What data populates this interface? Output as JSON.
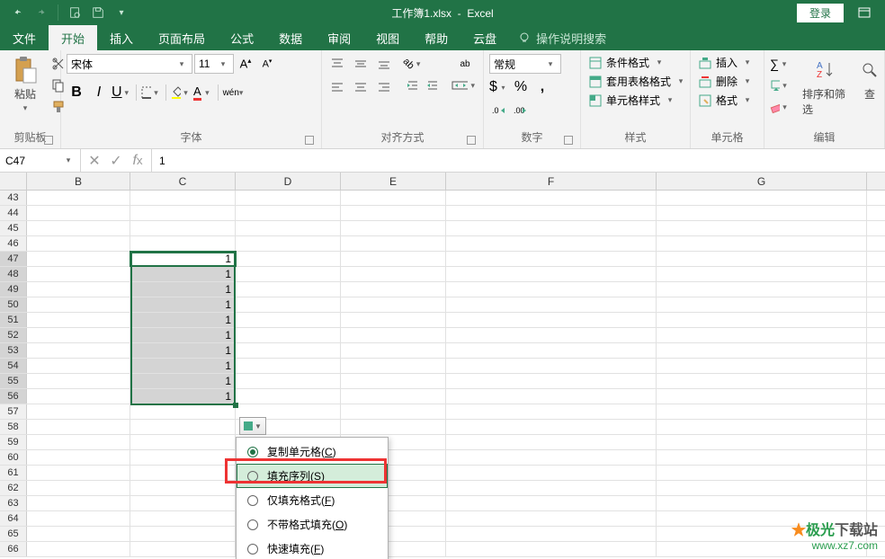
{
  "title": {
    "filename": "工作簿1.xlsx",
    "app": "Excel",
    "separator": "-"
  },
  "login_button": "登录",
  "tabs": {
    "file": "文件",
    "home": "开始",
    "insert": "插入",
    "layout": "页面布局",
    "formula": "公式",
    "data": "数据",
    "review": "审阅",
    "view": "视图",
    "help": "帮助",
    "cloud": "云盘",
    "tellme": "操作说明搜索"
  },
  "ribbon": {
    "clipboard": {
      "label": "剪贴板",
      "paste": "粘贴"
    },
    "font": {
      "label": "字体",
      "name": "宋体",
      "size": "11",
      "bold": "B",
      "italic": "I",
      "underline": "U",
      "ruby": "wén"
    },
    "alignment": {
      "label": "对齐方式",
      "wrap": "ab"
    },
    "number": {
      "label": "数字",
      "format": "常规",
      "currency": "$",
      "percent": "%",
      "comma": ","
    },
    "styles": {
      "label": "样式",
      "cond": "条件格式",
      "table": "套用表格格式",
      "cell": "单元格样式"
    },
    "cells": {
      "label": "单元格",
      "insert": "插入",
      "delete": "删除",
      "format": "格式"
    },
    "editing": {
      "label": "编辑",
      "sort": "排序和筛选",
      "find": "查"
    }
  },
  "name_box": "C47",
  "formula": "1",
  "columns": [
    "B",
    "C",
    "D",
    "E",
    "F",
    "G"
  ],
  "row_start": 43,
  "row_end": 66,
  "filled_rows": [
    47,
    48,
    49,
    50,
    51,
    52,
    53,
    54,
    55,
    56
  ],
  "fill_value": "1",
  "autofill_menu": {
    "copy": "复制单元格(",
    "copy_key": "C",
    "series": "填充序列(",
    "series_key": "S",
    "fmt_only": "仅填充格式(",
    "fmt_only_key": "F",
    "no_fmt": "不带格式填充(",
    "no_fmt_key": "O",
    "flash": "快速填充(",
    "flash_key": "F",
    "close": ")"
  },
  "watermark": {
    "text1": "极光",
    "text2": "下载站",
    "url": "www.xz7.com"
  }
}
